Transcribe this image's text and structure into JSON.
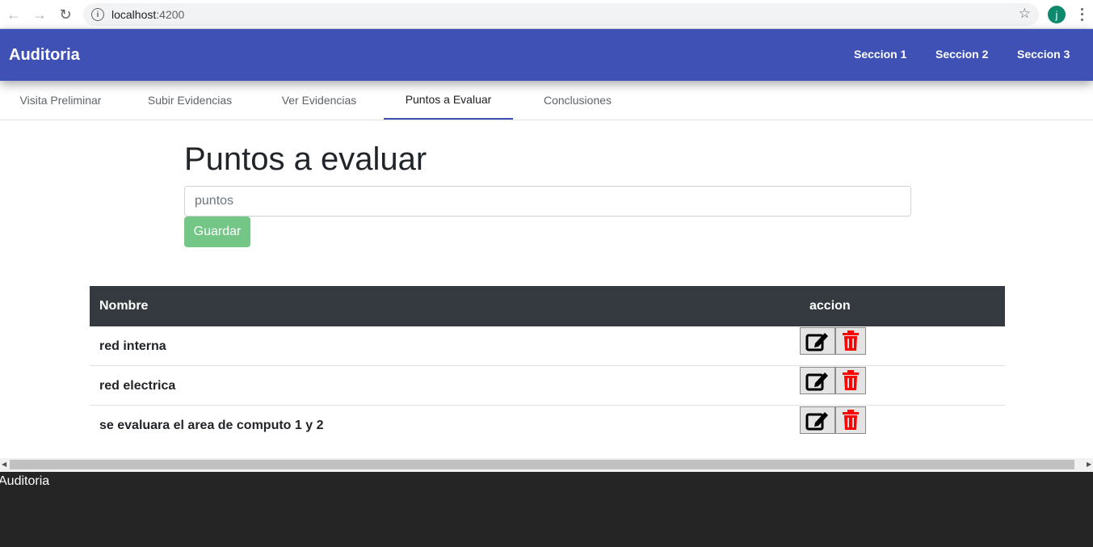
{
  "browser": {
    "url_host": "localhost",
    "url_port": ":4200",
    "avatar_letter": "j"
  },
  "app": {
    "title": "Auditoria",
    "nav": [
      "Seccion 1",
      "Seccion 2",
      "Seccion 3"
    ],
    "brand_color": "#3f51b5"
  },
  "tabs": [
    {
      "label": "Visita Preliminar",
      "active": false
    },
    {
      "label": "Subir Evidencias",
      "active": false
    },
    {
      "label": "Ver Evidencias",
      "active": false
    },
    {
      "label": "Puntos a Evaluar",
      "active": true
    },
    {
      "label": "Conclusiones",
      "active": false
    }
  ],
  "main": {
    "title": "Puntos a evaluar",
    "input_placeholder": "puntos",
    "save_label": "Guardar"
  },
  "table": {
    "headers": [
      "Nombre",
      "accion"
    ],
    "rows": [
      {
        "nombre": "red interna"
      },
      {
        "nombre": "red electrica"
      },
      {
        "nombre": "se evaluara el area de computo 1 y 2"
      }
    ]
  },
  "footer": {
    "text": "Auditoria"
  },
  "icons": {
    "edit": "edit-icon",
    "delete": "trash-icon"
  }
}
